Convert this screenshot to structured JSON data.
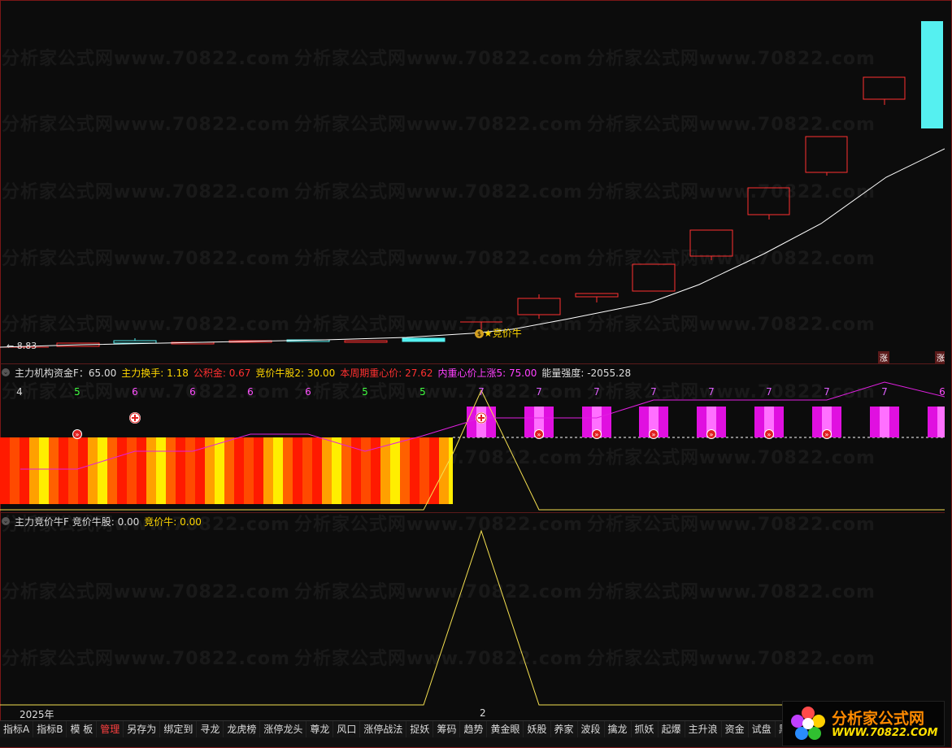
{
  "watermark": "分析家公式网www.70822.com",
  "main": {
    "price_label": "8.83",
    "marker_label": "竞价牛",
    "vtags": [
      "涨",
      "涨"
    ]
  },
  "ind1": {
    "header": [
      {
        "text": "主力机构资金F：65.00",
        "color": "#dddddd"
      },
      {
        "text": "主力换手: 1.18",
        "color": "#ffd700"
      },
      {
        "text": "公积金: 0.67",
        "color": "#ff3030"
      },
      {
        "text": "竞价牛股2: 30.00",
        "color": "#ffd700"
      },
      {
        "text": "本周期重心价: 27.62",
        "color": "#ff3030"
      },
      {
        "text": "内重心价上涨5: 75.00",
        "color": "#ff40ff"
      },
      {
        "text": "能量强度: -2055.28",
        "color": "#dddddd"
      }
    ],
    "top_numbers": [
      "4",
      "5",
      "6",
      "6",
      "6",
      "6",
      "5",
      "5",
      "7",
      "7",
      "7",
      "7",
      "7",
      "7",
      "7",
      "7",
      "6"
    ]
  },
  "ind2": {
    "header": [
      {
        "text": "主力竞价牛F 竞价牛股: 0.00",
        "color": "#dddddd"
      },
      {
        "text": "竞价牛: 0.00",
        "color": "#ffd700"
      }
    ]
  },
  "xaxis": {
    "year": "2025年",
    "month": "2"
  },
  "toolbar": [
    {
      "label": "指标A",
      "active": false
    },
    {
      "label": "指标B",
      "active": false
    },
    {
      "label": "模 板",
      "active": false
    },
    {
      "label": "管理",
      "active": true
    },
    {
      "label": "另存为",
      "active": false
    },
    {
      "label": "绑定到",
      "active": false
    },
    {
      "label": "寻龙",
      "active": false
    },
    {
      "label": "龙虎榜",
      "active": false
    },
    {
      "label": "涨停龙头",
      "active": false
    },
    {
      "label": "尊龙",
      "active": false
    },
    {
      "label": "风口",
      "active": false
    },
    {
      "label": "涨停战法",
      "active": false
    },
    {
      "label": "捉妖",
      "active": false
    },
    {
      "label": "筹码",
      "active": false
    },
    {
      "label": "趋势",
      "active": false
    },
    {
      "label": "黄金眼",
      "active": false
    },
    {
      "label": "妖股",
      "active": false
    },
    {
      "label": "养家",
      "active": false
    },
    {
      "label": "波段",
      "active": false
    },
    {
      "label": "擒龙",
      "active": false
    },
    {
      "label": "抓妖",
      "active": false
    },
    {
      "label": "起爆",
      "active": false
    },
    {
      "label": "主升浪",
      "active": false
    },
    {
      "label": "资金",
      "active": false
    },
    {
      "label": "试盘",
      "active": false
    },
    {
      "label": "黑马",
      "active": false
    }
  ],
  "logo": {
    "title": "分析家公式网",
    "url": "WWW.70822.COM"
  },
  "colors": {
    "up": "#ff3030",
    "down": "#55f0f0",
    "ma": "#ffffff",
    "magenta": "#ff00ff",
    "yellow": "#f5e050"
  }
}
